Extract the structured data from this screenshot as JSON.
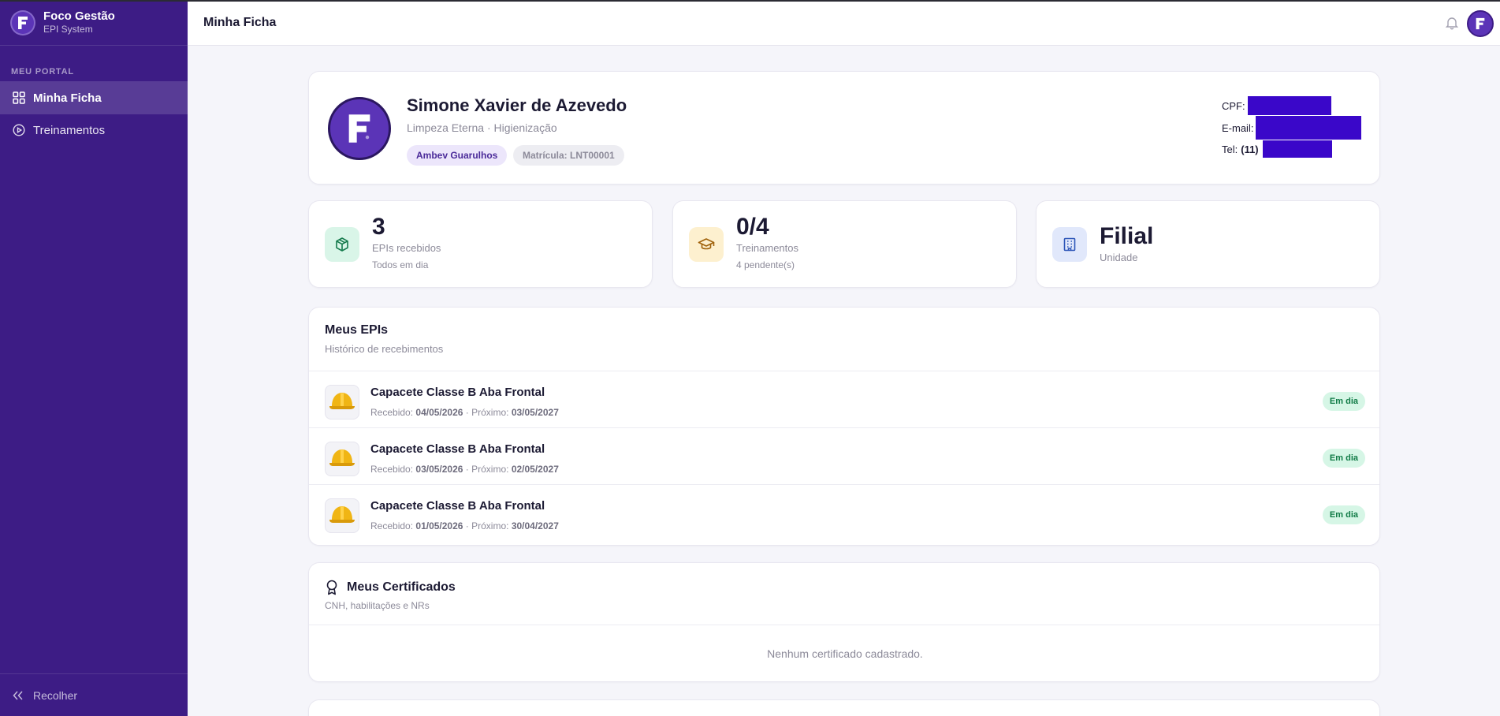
{
  "app": {
    "title": "Foco Gestão",
    "subtitle": "EPI System",
    "accent": "#3d1c85",
    "brand": "#5b34b7"
  },
  "sidebar": {
    "section_label": "MEU PORTAL",
    "items": [
      {
        "label": "Minha Ficha",
        "icon": "grid-icon",
        "active": true
      },
      {
        "label": "Treinamentos",
        "icon": "play-circle-icon",
        "active": false
      }
    ],
    "collapse_label": "Recolher"
  },
  "header": {
    "title": "Minha Ficha"
  },
  "profile": {
    "name": "Simone Xavier de Azevedo",
    "subtitle": "Limpeza Eterna · Higienização",
    "unit_chip": "Ambev Guarulhos",
    "matricula_chip": "Matrícula: LNT00001",
    "cpf_label": "CPF:",
    "email_label": "E-mail:",
    "tel_label": "Tel:",
    "tel_prefix": "(11)"
  },
  "stats": [
    {
      "value": "3",
      "label": "EPIs recebidos",
      "note": "Todos em dia",
      "icon": "box-icon",
      "color": "#d9f5e8"
    },
    {
      "value": "0/4",
      "label": "Treinamentos",
      "note": "4 pendente(s)",
      "icon": "graduation-cap-icon",
      "color": "#fdf0cf"
    },
    {
      "value": "Filial",
      "label": "Unidade",
      "icon": "building-icon",
      "color": "#e1e8fb"
    }
  ],
  "epis": {
    "title": "Meus EPIs",
    "subtitle": "Histórico de recebimentos",
    "received_label": "Recebido:",
    "next_label": "Próximo:",
    "items": [
      {
        "name": "Capacete Classe B Aba Frontal",
        "received": "04/05/2026",
        "next": "03/05/2027",
        "status": "Em dia"
      },
      {
        "name": "Capacete Classe B Aba Frontal",
        "received": "03/05/2026",
        "next": "02/05/2027",
        "status": "Em dia"
      },
      {
        "name": "Capacete Classe B Aba Frontal",
        "received": "01/05/2026",
        "next": "30/04/2027",
        "status": "Em dia"
      }
    ]
  },
  "certs": {
    "title": "Meus Certificados",
    "subtitle": "CNH, habilitações e NRs",
    "empty": "Nenhum certificado cadastrado."
  }
}
